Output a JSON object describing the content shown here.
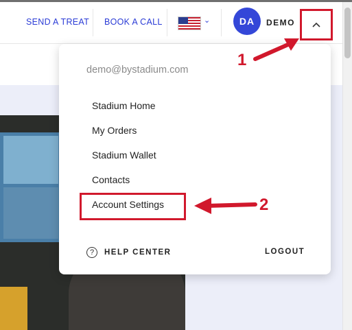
{
  "header": {
    "send_treat": "SEND A TREAT",
    "book_call": "BOOK A CALL",
    "avatar_initials": "DA",
    "user_name": "DEMO",
    "flag_icon": "us-flag-icon"
  },
  "dropdown": {
    "email": "demo@bystadium.com",
    "items": [
      {
        "label": "Stadium Home"
      },
      {
        "label": "My Orders"
      },
      {
        "label": "Stadium Wallet"
      },
      {
        "label": "Contacts"
      },
      {
        "label": "Account Settings"
      }
    ],
    "help_center": "HELP CENTER",
    "logout": "LOGOUT"
  },
  "annotations": {
    "step1": "1",
    "step2": "2",
    "color": "#d1182c"
  },
  "colors": {
    "brand_blue": "#3447d8",
    "link_blue": "#2a3bd6"
  }
}
